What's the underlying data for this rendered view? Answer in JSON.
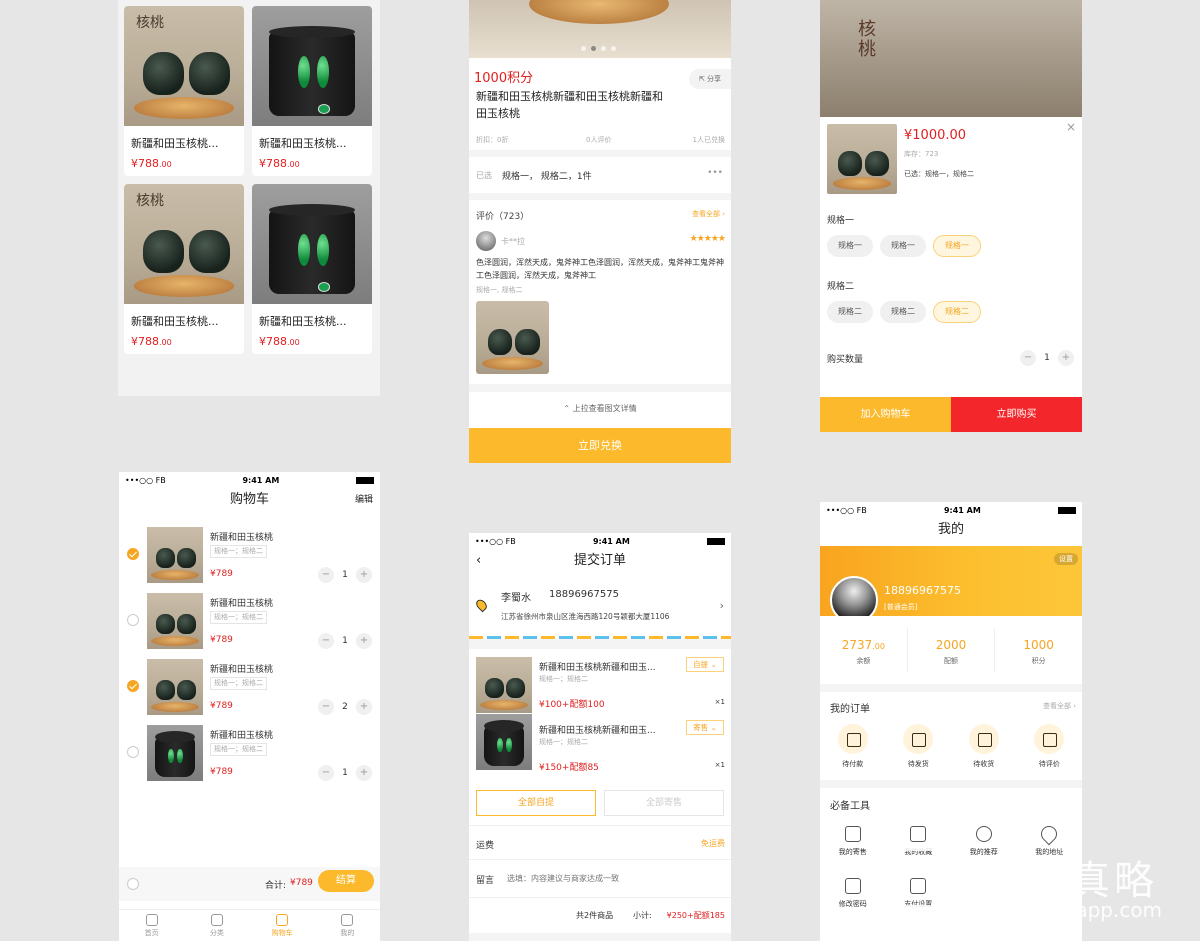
{
  "grid_screen": {
    "products": [
      {
        "name": "新疆和田玉核桃...",
        "price_main": "¥788",
        "price_dec": ".00",
        "image": "walnut-icon",
        "img_text": "核桃"
      },
      {
        "name": "新疆和田玉核桃...",
        "price_main": "¥788",
        "price_dec": ".00",
        "image": "jade-icon",
        "img_text": ""
      },
      {
        "name": "新疆和田玉核桃...",
        "price_main": "¥788",
        "price_dec": ".00",
        "image": "walnut-icon",
        "img_text": "核桃"
      },
      {
        "name": "新疆和田玉核桃...",
        "price_main": "¥788",
        "price_dec": ".00",
        "image": "jade-icon",
        "img_text": ""
      }
    ]
  },
  "detail_screen": {
    "points": "1000积分",
    "share_label": "分享",
    "title": "新疆和田玉核桃新疆和田玉核桃新疆和田玉核桃",
    "discount": "折扣：0折",
    "review_count": "0人评价",
    "bought": "1人已兑换",
    "selected_label": "已选",
    "selected_value": "规格一， 规格二，1件",
    "reviews_title": "评价（723）",
    "view_all": "查看全部",
    "reviewer": "卡**拉",
    "stars": "★★★★★",
    "review_text": "色泽圆润，浑然天成，鬼斧神工色泽圆润，浑然天成，鬼斧神工鬼斧神工色泽圆润，浑然天成，鬼斧神工",
    "review_spec": "规格一, 规格二",
    "pull_hint": "上拉查看图文详情",
    "redeem_button": "立即兑换",
    "carousel_dots": 4,
    "carousel_active": 1
  },
  "spec_screen": {
    "banner_text": "核桃",
    "price": "¥1000.00",
    "stock": "库存：723",
    "selected": "已选：规格一，规格二",
    "group1_title": "规格一",
    "group1_options": [
      "规格一",
      "规格一",
      "规格一"
    ],
    "group2_title": "规格二",
    "group2_options": [
      "规格二",
      "规格二",
      "规格二"
    ],
    "selected_index": 2,
    "quantity_label": "购买数量",
    "quantity": "1",
    "add_cart": "加入购物车",
    "buy_now": "立即购买"
  },
  "cart_screen": {
    "status": {
      "carrier": "•••○○ FB",
      "time": "9:41 AM"
    },
    "title": "购物车",
    "edit": "编辑",
    "items": [
      {
        "name": "新疆和田玉核桃",
        "spec": "规格一；规格二",
        "price": "¥789",
        "qty": "1",
        "checked": true,
        "image": "walnut-icon"
      },
      {
        "name": "新疆和田玉核桃",
        "spec": "规格一；规格二",
        "price": "¥789",
        "qty": "1",
        "checked": false,
        "image": "walnut-icon"
      },
      {
        "name": "新疆和田玉核桃",
        "spec": "规格一；规格二",
        "price": "¥789",
        "qty": "2",
        "checked": true,
        "image": "walnut-icon"
      },
      {
        "name": "新疆和田玉核桃",
        "spec": "规格一；规格二",
        "price": "¥789",
        "qty": "1",
        "checked": false,
        "image": "jade-icon"
      }
    ],
    "total_label": "合计:",
    "total_value": "¥789",
    "checkout": "结算",
    "tabs": [
      "首页",
      "分类",
      "购物车",
      "我的"
    ],
    "active_tab": 2
  },
  "order_screen": {
    "status": {
      "carrier": "•••○○ FB",
      "time": "9:41 AM"
    },
    "title": "提交订单",
    "recipient": "李蜀水",
    "phone": "18896967575",
    "address": "江苏省徐州市泉山区淮海西路120号颖都大厦1106",
    "items": [
      {
        "name": "新疆和田玉核桃新疆和田玉...",
        "spec": "规格一；规格二",
        "badge": "自提",
        "price": "¥100+配额100",
        "qty": "×1",
        "image": "walnut-icon"
      },
      {
        "name": "新疆和田玉核桃新疆和田玉...",
        "spec": "规格一；规格二",
        "badge": "寄售",
        "price": "¥150+配额85",
        "qty": "×1",
        "image": "jade-icon"
      }
    ],
    "all_pickup": "全部自提",
    "all_consign": "全部寄售",
    "shipping_label": "运费",
    "shipping_value": "免运费",
    "message_label": "留言",
    "message_placeholder": "选填：内容建议与商家达成一致",
    "summary_count": "共2件商品",
    "summary_label": "小计:",
    "summary_value": "¥250+配额185"
  },
  "profile_screen": {
    "status": {
      "carrier": "•••○○ FB",
      "time": "9:41 AM"
    },
    "title": "我的",
    "settings": "设置",
    "phone": "18896967575",
    "member": "[普通会员]",
    "stats": [
      {
        "value": "2737",
        "dec": ".00",
        "label": "余额"
      },
      {
        "value": "2000",
        "dec": "",
        "label": "配额"
      },
      {
        "value": "1000",
        "dec": "",
        "label": "积分"
      }
    ],
    "orders_title": "我的订单",
    "orders_view_all": "查看全部",
    "order_states": [
      {
        "label": "待付款",
        "icon": "wallet-icon"
      },
      {
        "label": "待发货",
        "icon": "box-icon"
      },
      {
        "label": "待收货",
        "icon": "truck-icon"
      },
      {
        "label": "待评价",
        "icon": "pencil-icon"
      }
    ],
    "tools_title": "必备工具",
    "tools": [
      {
        "label": "我的寄售",
        "icon": "bag-icon"
      },
      {
        "label": "我的收藏",
        "icon": "bookmark-icon"
      },
      {
        "label": "我的推荐",
        "icon": "users-icon"
      },
      {
        "label": "我的地址",
        "icon": "location-icon"
      },
      {
        "label": "修改密码",
        "icon": "lock-icon"
      },
      {
        "label": "支付设置",
        "icon": "card-icon"
      }
    ]
  },
  "watermark": {
    "brand_cn": "上海真略",
    "url": "www.cnzlapp.com"
  }
}
